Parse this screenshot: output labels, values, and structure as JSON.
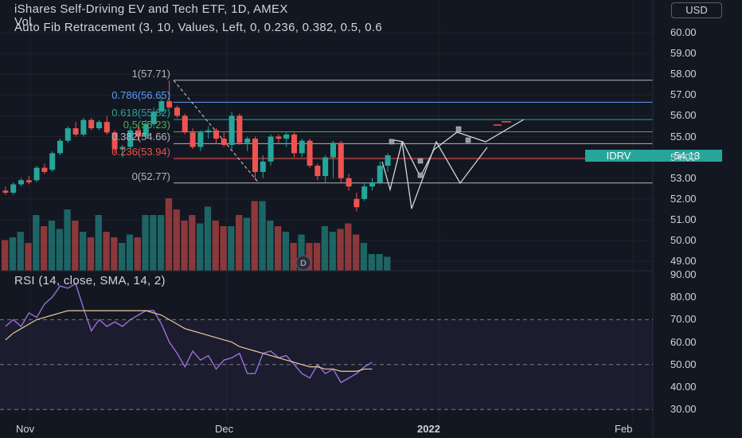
{
  "legend": {
    "title": "iShares Self-Driving EV and Tech ETF, 1D, AMEX",
    "volume": "Vol",
    "fib": "Auto Fib Retracement (3, 10, Values, Left, 0, 0.236, 0.382, 0.5, 0.6",
    "rsi": "RSI (14, close, SMA, 14, 2)"
  },
  "currency": "USD",
  "ticker_tag": {
    "symbol": "IDRV",
    "price": "54.13"
  },
  "fib_levels": [
    {
      "label": "1(57.71)",
      "value": 57.71,
      "color": "#b2b5be"
    },
    {
      "label": "0.786(56.65)",
      "value": 56.65,
      "color": "#5b9cf6"
    },
    {
      "label": "0.618(55.82)",
      "value": 55.82,
      "color": "#26a69a"
    },
    {
      "label": "0.5(55.23)",
      "value": 55.23,
      "color": "#4caf50"
    },
    {
      "label": "0.382(54.66)",
      "value": 54.66,
      "color": "#b2b5be"
    },
    {
      "label": "0.236(53.94)",
      "value": 53.94,
      "color": "#ef5350"
    },
    {
      "label": "0(52.77)",
      "value": 52.77,
      "color": "#b2b5be"
    }
  ],
  "price_axis": [
    "60.00",
    "59.00",
    "58.00",
    "57.00",
    "56.00",
    "55.00",
    "54.00",
    "53.00",
    "52.00",
    "51.00",
    "50.00",
    "49.00"
  ],
  "rsi_axis": [
    "90.00",
    "80.00",
    "70.00",
    "60.00",
    "50.00",
    "40.00",
    "30.00"
  ],
  "time_axis": [
    "Nov",
    "Dec",
    "2022",
    "Feb"
  ],
  "colors": {
    "up": "#26a69a",
    "down": "#ef5350",
    "background": "#131722",
    "rsi_line": "#9c6fd6",
    "rsi_ma": "#e8c99b"
  },
  "chart_data": [
    {
      "type": "candlestick",
      "title": "iShares Self-Driving EV and Tech ETF, 1D, AMEX",
      "ylim": [
        48.5,
        61.0
      ],
      "x_labels": [
        "Nov",
        "Dec",
        "2022",
        "Feb"
      ],
      "series": [
        {
          "name": "IDRV",
          "ohlc": [
            [
              52.4,
              52.6,
              52.2,
              52.3
            ],
            [
              52.3,
              52.8,
              52.2,
              52.7
            ],
            [
              52.7,
              53.0,
              52.6,
              52.9
            ],
            [
              52.9,
              53.1,
              52.7,
              52.8
            ],
            [
              52.9,
              53.6,
              52.8,
              53.5
            ],
            [
              53.5,
              53.7,
              53.2,
              53.3
            ],
            [
              53.4,
              54.3,
              53.3,
              54.2
            ],
            [
              54.2,
              54.9,
              54.1,
              54.8
            ],
            [
              54.8,
              55.5,
              54.7,
              55.4
            ],
            [
              55.4,
              55.7,
              55.0,
              55.1
            ],
            [
              55.1,
              55.9,
              55.0,
              55.8
            ],
            [
              55.8,
              55.9,
              55.3,
              55.4
            ],
            [
              55.4,
              55.8,
              55.3,
              55.7
            ],
            [
              55.7,
              56.0,
              55.1,
              55.2
            ],
            [
              55.2,
              55.3,
              54.2,
              54.4
            ],
            [
              54.4,
              54.6,
              54.0,
              54.5
            ],
            [
              54.5,
              55.5,
              54.4,
              55.3
            ],
            [
              55.3,
              55.5,
              54.8,
              55.0
            ],
            [
              55.0,
              55.8,
              54.9,
              55.6
            ],
            [
              55.6,
              56.4,
              55.5,
              56.2
            ],
            [
              56.2,
              56.9,
              56.1,
              56.7
            ],
            [
              56.7,
              57.7,
              56.3,
              56.4
            ],
            [
              56.4,
              56.5,
              55.9,
              56.0
            ],
            [
              56.0,
              56.1,
              55.1,
              55.2
            ],
            [
              55.2,
              55.4,
              54.4,
              54.5
            ],
            [
              54.5,
              55.3,
              54.3,
              55.2
            ],
            [
              55.2,
              55.5,
              54.9,
              55.3
            ],
            [
              55.3,
              55.4,
              54.7,
              54.9
            ],
            [
              54.9,
              55.2,
              54.5,
              54.6
            ],
            [
              54.6,
              56.2,
              54.4,
              56.0
            ],
            [
              56.0,
              56.1,
              54.6,
              54.7
            ],
            [
              54.7,
              55.0,
              54.3,
              54.9
            ],
            [
              54.9,
              55.0,
              52.9,
              53.3
            ],
            [
              53.3,
              54.1,
              53.0,
              53.8
            ],
            [
              53.8,
              55.1,
              53.6,
              55.0
            ],
            [
              55.0,
              55.1,
              54.7,
              54.9
            ],
            [
              54.9,
              55.2,
              54.5,
              55.1
            ],
            [
              55.1,
              55.2,
              54.0,
              54.2
            ],
            [
              54.2,
              54.9,
              54.0,
              54.8
            ],
            [
              54.8,
              54.9,
              53.5,
              53.6
            ],
            [
              53.6,
              53.7,
              52.9,
              53.1
            ],
            [
              53.1,
              54.1,
              52.8,
              54.0
            ],
            [
              54.0,
              54.8,
              53.0,
              54.7
            ],
            [
              54.7,
              54.8,
              52.8,
              53.0
            ],
            [
              53.0,
              53.2,
              52.4,
              52.6
            ],
            [
              52.0,
              52.3,
              51.4,
              51.6
            ],
            [
              52.0,
              52.8,
              51.9,
              52.6
            ],
            [
              52.6,
              53.0,
              52.4,
              52.8
            ],
            [
              52.8,
              53.8,
              52.7,
              53.6
            ],
            [
              53.6,
              54.2,
              53.3,
              54.1
            ]
          ],
          "volume": [
            11,
            12,
            14,
            10,
            20,
            16,
            18,
            15,
            22,
            18,
            14,
            12,
            20,
            14,
            12,
            10,
            13,
            12,
            20,
            20,
            20,
            26,
            22,
            18,
            20,
            17,
            23,
            18,
            16,
            16,
            20,
            19,
            25,
            25,
            18,
            16,
            14,
            10,
            13,
            10,
            10,
            16,
            14,
            15,
            17,
            13,
            10,
            6,
            6,
            5
          ]
        }
      ]
    },
    {
      "type": "line",
      "title": "RSI (14, close, SMA, 14, 2)",
      "ylim": [
        25,
        92
      ],
      "series": [
        {
          "name": "RSI",
          "values": [
            67,
            70,
            67,
            73,
            71,
            77,
            80,
            85,
            84,
            86,
            75,
            65,
            70,
            67,
            69,
            67,
            70,
            72,
            74,
            74,
            68,
            60,
            55,
            49,
            56,
            52,
            54,
            48,
            52,
            53,
            55,
            46,
            46,
            55,
            56,
            53,
            54,
            50,
            46,
            44,
            50,
            46,
            48,
            42,
            44,
            46,
            49,
            51
          ]
        },
        {
          "name": "SMA",
          "values": [
            61,
            64,
            66,
            68,
            70,
            71,
            72,
            73,
            74,
            74,
            74,
            74,
            74,
            74,
            74,
            74,
            74,
            74,
            74,
            73,
            72,
            70,
            68,
            66,
            65,
            64,
            63,
            62,
            61,
            60,
            58,
            57,
            56,
            55,
            54,
            53,
            52,
            51,
            50,
            49,
            49,
            48,
            48,
            47,
            47,
            47,
            48,
            48
          ]
        }
      ],
      "bands": [
        70,
        50,
        30
      ]
    }
  ]
}
